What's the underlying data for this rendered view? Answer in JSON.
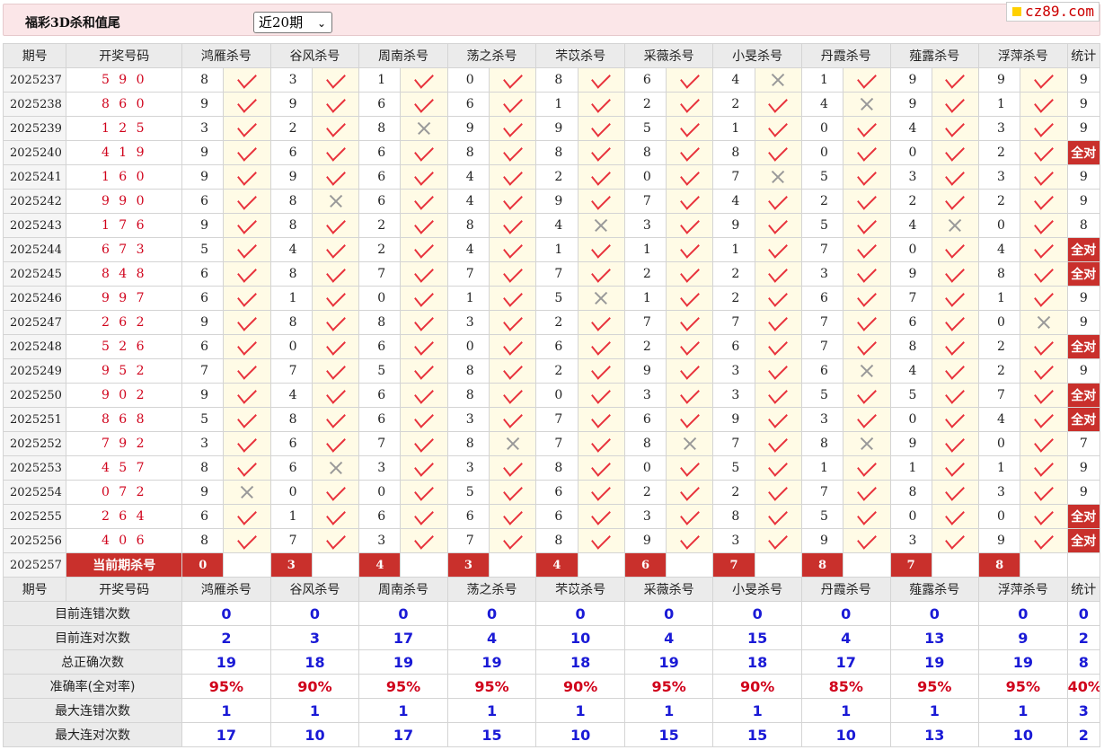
{
  "header": {
    "title": "福彩3D杀和值尾",
    "period_select": "近20期",
    "logo": "cz89.com"
  },
  "columns": {
    "period": "期号",
    "draw": "开奖号码",
    "stat": "统计",
    "experts": [
      "鸿雁杀号",
      "谷风杀号",
      "周南杀号",
      "荡之杀号",
      "芣苡杀号",
      "采薇杀号",
      "小旻杀号",
      "丹霞杀号",
      "薤露杀号",
      "浮萍杀号"
    ]
  },
  "rows": [
    {
      "period": "2025237",
      "draw": "5 9 0",
      "kills": [
        "8",
        "3",
        "1",
        "0",
        "8",
        "6",
        "4",
        "1",
        "9",
        "9"
      ],
      "marks": [
        "ok",
        "ok",
        "ok",
        "ok",
        "ok",
        "ok",
        "err",
        "ok",
        "ok",
        "ok"
      ],
      "stat": "9"
    },
    {
      "period": "2025238",
      "draw": "8 6 0",
      "kills": [
        "9",
        "9",
        "6",
        "6",
        "1",
        "2",
        "2",
        "4",
        "9",
        "1"
      ],
      "marks": [
        "ok",
        "ok",
        "ok",
        "ok",
        "ok",
        "ok",
        "ok",
        "err",
        "ok",
        "ok"
      ],
      "stat": "9"
    },
    {
      "period": "2025239",
      "draw": "1 2 5",
      "kills": [
        "3",
        "2",
        "8",
        "9",
        "9",
        "5",
        "1",
        "0",
        "4",
        "3"
      ],
      "marks": [
        "ok",
        "ok",
        "err",
        "ok",
        "ok",
        "ok",
        "ok",
        "ok",
        "ok",
        "ok"
      ],
      "stat": "9"
    },
    {
      "period": "2025240",
      "draw": "4 1 9",
      "kills": [
        "9",
        "6",
        "6",
        "8",
        "8",
        "8",
        "8",
        "0",
        "0",
        "2"
      ],
      "marks": [
        "ok",
        "ok",
        "ok",
        "ok",
        "ok",
        "ok",
        "ok",
        "ok",
        "ok",
        "ok"
      ],
      "stat": "全对"
    },
    {
      "period": "2025241",
      "draw": "1 6 0",
      "kills": [
        "9",
        "9",
        "6",
        "4",
        "2",
        "0",
        "7",
        "5",
        "3",
        "3"
      ],
      "marks": [
        "ok",
        "ok",
        "ok",
        "ok",
        "ok",
        "ok",
        "err",
        "ok",
        "ok",
        "ok"
      ],
      "stat": "9"
    },
    {
      "period": "2025242",
      "draw": "9 9 0",
      "kills": [
        "6",
        "8",
        "6",
        "4",
        "9",
        "7",
        "4",
        "2",
        "2",
        "2"
      ],
      "marks": [
        "ok",
        "err",
        "ok",
        "ok",
        "ok",
        "ok",
        "ok",
        "ok",
        "ok",
        "ok"
      ],
      "stat": "9"
    },
    {
      "period": "2025243",
      "draw": "1 7 6",
      "kills": [
        "9",
        "8",
        "2",
        "8",
        "4",
        "3",
        "9",
        "5",
        "4",
        "0"
      ],
      "marks": [
        "ok",
        "ok",
        "ok",
        "ok",
        "err",
        "ok",
        "ok",
        "ok",
        "err",
        "ok"
      ],
      "stat": "8"
    },
    {
      "period": "2025244",
      "draw": "6 7 3",
      "kills": [
        "5",
        "4",
        "2",
        "4",
        "1",
        "1",
        "1",
        "7",
        "0",
        "4"
      ],
      "marks": [
        "ok",
        "ok",
        "ok",
        "ok",
        "ok",
        "ok",
        "ok",
        "ok",
        "ok",
        "ok"
      ],
      "stat": "全对"
    },
    {
      "period": "2025245",
      "draw": "8 4 8",
      "kills": [
        "6",
        "8",
        "7",
        "7",
        "7",
        "2",
        "2",
        "3",
        "9",
        "8"
      ],
      "marks": [
        "ok",
        "ok",
        "ok",
        "ok",
        "ok",
        "ok",
        "ok",
        "ok",
        "ok",
        "ok"
      ],
      "stat": "全对"
    },
    {
      "period": "2025246",
      "draw": "9 9 7",
      "kills": [
        "6",
        "1",
        "0",
        "1",
        "5",
        "1",
        "2",
        "6",
        "7",
        "1"
      ],
      "marks": [
        "ok",
        "ok",
        "ok",
        "ok",
        "err",
        "ok",
        "ok",
        "ok",
        "ok",
        "ok"
      ],
      "stat": "9"
    },
    {
      "period": "2025247",
      "draw": "2 6 2",
      "kills": [
        "9",
        "8",
        "8",
        "3",
        "2",
        "7",
        "7",
        "7",
        "6",
        "0"
      ],
      "marks": [
        "ok",
        "ok",
        "ok",
        "ok",
        "ok",
        "ok",
        "ok",
        "ok",
        "ok",
        "err"
      ],
      "stat": "9"
    },
    {
      "period": "2025248",
      "draw": "5 2 6",
      "kills": [
        "6",
        "0",
        "6",
        "0",
        "6",
        "2",
        "6",
        "7",
        "8",
        "2"
      ],
      "marks": [
        "ok",
        "ok",
        "ok",
        "ok",
        "ok",
        "ok",
        "ok",
        "ok",
        "ok",
        "ok"
      ],
      "stat": "全对"
    },
    {
      "period": "2025249",
      "draw": "9 5 2",
      "kills": [
        "7",
        "7",
        "5",
        "8",
        "2",
        "9",
        "3",
        "6",
        "4",
        "2"
      ],
      "marks": [
        "ok",
        "ok",
        "ok",
        "ok",
        "ok",
        "ok",
        "ok",
        "err",
        "ok",
        "ok"
      ],
      "stat": "9"
    },
    {
      "period": "2025250",
      "draw": "9 0 2",
      "kills": [
        "9",
        "4",
        "6",
        "8",
        "0",
        "3",
        "3",
        "5",
        "5",
        "7"
      ],
      "marks": [
        "ok",
        "ok",
        "ok",
        "ok",
        "ok",
        "ok",
        "ok",
        "ok",
        "ok",
        "ok"
      ],
      "stat": "全对"
    },
    {
      "period": "2025251",
      "draw": "8 6 8",
      "kills": [
        "5",
        "8",
        "6",
        "3",
        "7",
        "6",
        "9",
        "3",
        "0",
        "4"
      ],
      "marks": [
        "ok",
        "ok",
        "ok",
        "ok",
        "ok",
        "ok",
        "ok",
        "ok",
        "ok",
        "ok"
      ],
      "stat": "全对"
    },
    {
      "period": "2025252",
      "draw": "7 9 2",
      "kills": [
        "3",
        "6",
        "7",
        "8",
        "7",
        "8",
        "7",
        "8",
        "9",
        "0"
      ],
      "marks": [
        "ok",
        "ok",
        "ok",
        "err",
        "ok",
        "err",
        "ok",
        "err",
        "ok",
        "ok"
      ],
      "stat": "7"
    },
    {
      "period": "2025253",
      "draw": "4 5 7",
      "kills": [
        "8",
        "6",
        "3",
        "3",
        "8",
        "0",
        "5",
        "1",
        "1",
        "1"
      ],
      "marks": [
        "ok",
        "err",
        "ok",
        "ok",
        "ok",
        "ok",
        "ok",
        "ok",
        "ok",
        "ok"
      ],
      "stat": "9"
    },
    {
      "period": "2025254",
      "draw": "0 7 2",
      "kills": [
        "9",
        "0",
        "0",
        "5",
        "6",
        "2",
        "2",
        "7",
        "8",
        "3"
      ],
      "marks": [
        "err",
        "ok",
        "ok",
        "ok",
        "ok",
        "ok",
        "ok",
        "ok",
        "ok",
        "ok"
      ],
      "stat": "9"
    },
    {
      "period": "2025255",
      "draw": "2 6 4",
      "kills": [
        "6",
        "1",
        "6",
        "6",
        "6",
        "3",
        "8",
        "5",
        "0",
        "0"
      ],
      "marks": [
        "ok",
        "ok",
        "ok",
        "ok",
        "ok",
        "ok",
        "ok",
        "ok",
        "ok",
        "ok"
      ],
      "stat": "全对"
    },
    {
      "period": "2025256",
      "draw": "4 0 6",
      "kills": [
        "8",
        "7",
        "3",
        "7",
        "8",
        "9",
        "3",
        "9",
        "3",
        "9"
      ],
      "marks": [
        "ok",
        "ok",
        "ok",
        "ok",
        "ok",
        "ok",
        "ok",
        "ok",
        "ok",
        "ok"
      ],
      "stat": "全对"
    }
  ],
  "current": {
    "period": "2025257",
    "label": "当前期杀号",
    "kills": [
      "0",
      "3",
      "4",
      "3",
      "4",
      "6",
      "7",
      "8",
      "7",
      "8"
    ]
  },
  "stats": [
    {
      "label": "目前连错次数",
      "values": [
        "0",
        "0",
        "0",
        "0",
        "0",
        "0",
        "0",
        "0",
        "0",
        "0"
      ],
      "stat": "0",
      "red": false
    },
    {
      "label": "目前连对次数",
      "values": [
        "2",
        "3",
        "17",
        "4",
        "10",
        "4",
        "15",
        "4",
        "13",
        "9"
      ],
      "stat": "2",
      "red": false
    },
    {
      "label": "总正确次数",
      "values": [
        "19",
        "18",
        "19",
        "19",
        "18",
        "19",
        "18",
        "17",
        "19",
        "19"
      ],
      "stat": "8",
      "red": false
    },
    {
      "label": "准确率(全对率)",
      "values": [
        "95%",
        "90%",
        "95%",
        "95%",
        "90%",
        "95%",
        "90%",
        "85%",
        "95%",
        "95%"
      ],
      "stat": "40%",
      "red": true
    },
    {
      "label": "最大连错次数",
      "values": [
        "1",
        "1",
        "1",
        "1",
        "1",
        "1",
        "1",
        "1",
        "1",
        "1"
      ],
      "stat": "3",
      "red": false
    },
    {
      "label": "最大连对次数",
      "values": [
        "17",
        "10",
        "17",
        "15",
        "10",
        "15",
        "15",
        "10",
        "13",
        "10"
      ],
      "stat": "2",
      "red": false
    }
  ],
  "colors": {
    "accent_red": "#c9302c",
    "check_red": "#e8323c",
    "stat_blue": "#1a1ad6",
    "header_bg": "#fbe6e8"
  }
}
